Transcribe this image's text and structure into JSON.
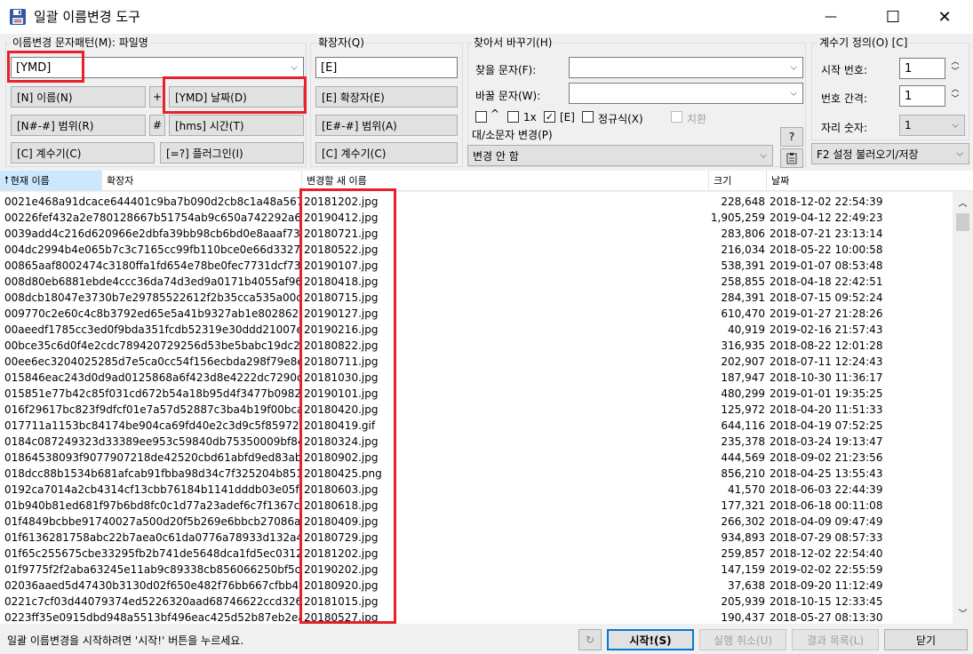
{
  "window": {
    "title": "일괄 이름변경 도구",
    "minimize": "—",
    "maximize": "☐",
    "close": "✕"
  },
  "pattern": {
    "group_label": "이름변경 문자패턴(M): 파일명",
    "value": "[YMD]",
    "buttons": {
      "name": "[N]  이름(N)",
      "plus": "+",
      "date": "[YMD]  날짜(D)",
      "range": "[N#-#]  범위(R)",
      "hash": "#",
      "time": "[hms]  시간(T)",
      "counter": "[C]  계수기(C)",
      "plugin": "[=?]  플러그인(I)"
    }
  },
  "extension": {
    "group_label": "확장자(Q)",
    "value": "[E]",
    "buttons": {
      "ext": "[E]  확장자(E)",
      "range": "[E#-#]  범위(A)",
      "counter": "[C]  계수기(C)"
    }
  },
  "find_replace": {
    "group_label": "찾아서 바꾸기(H)",
    "find_label": "찾을 문자(F):",
    "find_value": "",
    "replace_label": "바꿀 문자(W):",
    "replace_value": "",
    "opt_caret": "^",
    "opt_1x": "1x",
    "opt_e": "[E]",
    "opt_regex": "정규식(X)",
    "opt_replace": "치환",
    "case_label": "대/소문자 변경(P)",
    "case_value": "변경 안 함",
    "help": "?"
  },
  "counter": {
    "group_label": "계수기 정의(O) [C]",
    "start_label": "시작 번호:",
    "start_value": "1",
    "step_label": "번호 간격:",
    "step_value": "1",
    "digits_label": "자리 숫자:",
    "digits_value": "1",
    "settings": "F2 설정 불러오기/저장"
  },
  "columns": {
    "current": "현재 이름",
    "ext": "확장자",
    "new": "변경할 새 이름",
    "size": "크기",
    "date": "날짜"
  },
  "rows": [
    {
      "cur": "0021e468a91dcace644401c9ba7b090d2cb8c1a48a567.",
      "new": "20181202.jpg",
      "size": "228,648",
      "date": "2018-12-02 22:54:39"
    },
    {
      "cur": "00226fef432a2e780128667b51754ab9c650a742292a6ffd",
      "new": "20190412.jpg",
      "size": "1,905,259",
      "date": "2019-04-12 22:49:23"
    },
    {
      "cur": "0039add4c216d620966e2dbfa39bb98cb6bd0e8aaaf735",
      "new": "20180721.jpg",
      "size": "283,806",
      "date": "2018-07-21 23:13:14"
    },
    {
      "cur": "004dc2994b4e065b7c3c7165cc99fb110bce0e66d33278.",
      "new": "20180522.jpg",
      "size": "216,034",
      "date": "2018-05-22 10:00:58"
    },
    {
      "cur": "00865aaf8002474c3180ffa1fd654e78be0fec7731dcf7385.",
      "new": "20190107.jpg",
      "size": "538,391",
      "date": "2019-01-07 08:53:48"
    },
    {
      "cur": "008d80eb6881ebde4ccc36da74d3ed9a0171b4055af96.",
      "new": "20180418.jpg",
      "size": "258,855",
      "date": "2018-04-18 22:42:51"
    },
    {
      "cur": "008dcb18047e3730b7e29785522612f2b35cca535a00d8.",
      "new": "20180715.jpg",
      "size": "284,391",
      "date": "2018-07-15 09:52:24"
    },
    {
      "cur": "009770c2e60c4c8b3792ed65e5a41b9327ab1e8028620.",
      "new": "20190127.jpg",
      "size": "610,470",
      "date": "2019-01-27 21:28:26"
    },
    {
      "cur": "00aeedf1785cc3ed0f9bda351fcdb52319e30ddd21007e.",
      "new": "20190216.jpg",
      "size": "40,919",
      "date": "2019-02-16 21:57:43"
    },
    {
      "cur": "00bce35c6d0f4e2cdc789420729256d53be5babc19dc20",
      "new": "20180822.jpg",
      "size": "316,935",
      "date": "2018-08-22 12:01:28"
    },
    {
      "cur": "00ee6ec3204025285d7e5ca0cc54f156ecbda298f79e8e.",
      "new": "20180711.jpg",
      "size": "202,907",
      "date": "2018-07-11 12:24:43"
    },
    {
      "cur": "015846eac243d0d9ad0125868a6f423d8e4222dc7290d8",
      "new": "20181030.jpg",
      "size": "187,947",
      "date": "2018-10-30 11:36:17"
    },
    {
      "cur": "015851e77b42c85f031cd672b54a18b95d4f3477b098281",
      "new": "20190101.jpg",
      "size": "480,299",
      "date": "2019-01-01 19:35:25"
    },
    {
      "cur": "016f29617bc823f9dfcf01e7a57d52887c3ba4b19f00bca4.",
      "new": "20180420.jpg",
      "size": "125,972",
      "date": "2018-04-20 11:51:33"
    },
    {
      "cur": "017711a1153bc84174be904ca69fd40e2c3d9c5f8597290",
      "new": "20180419.gif",
      "size": "644,116",
      "date": "2018-04-19 07:52:25"
    },
    {
      "cur": "0184c087249323d33389ee953c59840db75350009bf84d.",
      "new": "20180324.jpg",
      "size": "235,378",
      "date": "2018-03-24 19:13:47"
    },
    {
      "cur": "01864538093f9077907218de42520cbd61abfd9ed83aba.",
      "new": "20180902.jpg",
      "size": "444,569",
      "date": "2018-09-02 21:23:56"
    },
    {
      "cur": "018dcc88b1534b681afcab91fbba98d34c7f325204b8517.",
      "new": "20180425.png",
      "size": "856,210",
      "date": "2018-04-25 13:55:43"
    },
    {
      "cur": "0192ca7014a2cb4314cf13cbb76184b1141dddb03e05fa.",
      "new": "20180603.jpg",
      "size": "41,570",
      "date": "2018-06-03 22:44:39"
    },
    {
      "cur": "01b940b81ed681f97b6bd8fc0c1d77a23adef6c7f1367c7.",
      "new": "20180618.jpg",
      "size": "177,321",
      "date": "2018-06-18 00:11:08"
    },
    {
      "cur": "01f4849bcbbe91740027a500d20f5b269e6bbcb27086ad.",
      "new": "20180409.jpg",
      "size": "266,302",
      "date": "2018-04-09 09:47:49"
    },
    {
      "cur": "01f6136281758abc22b7aea0c61da0776a78933d132a49",
      "new": "20180729.jpg",
      "size": "934,893",
      "date": "2018-07-29 08:57:33"
    },
    {
      "cur": "01f65c255675cbe33295fb2b741de5648dca1fd5ec0312d.",
      "new": "20181202.jpg",
      "size": "259,857",
      "date": "2018-12-02 22:54:40"
    },
    {
      "cur": "01f9775f2f2aba63245e11ab9c89338cb856066250bf5c82",
      "new": "20190202.jpg",
      "size": "147,159",
      "date": "2019-02-02 22:55:59"
    },
    {
      "cur": "02036aaed5d47430b3130d02f650e482f76bb667cfbb496",
      "new": "20180920.jpg",
      "size": "37,638",
      "date": "2018-09-20 11:12:49"
    },
    {
      "cur": "0221c7cf03d44079374ed5226320aad68746622ccd3260.",
      "new": "20181015.jpg",
      "size": "205,939",
      "date": "2018-10-15 12:33:45"
    },
    {
      "cur": "0223ff35e0915dbd948a5513bf496eac425d52b87eb2ea6",
      "new": "20180527.jpg",
      "size": "190,437",
      "date": "2018-05-27 08:13:30"
    }
  ],
  "status": {
    "message": "일괄 이름변경을 시작하려면 '시작!' 버튼을 누르세요.",
    "start": "시작!(S)",
    "cancel": "실행 취소(U)",
    "results": "결과 목록(L)",
    "close": "닫기"
  }
}
